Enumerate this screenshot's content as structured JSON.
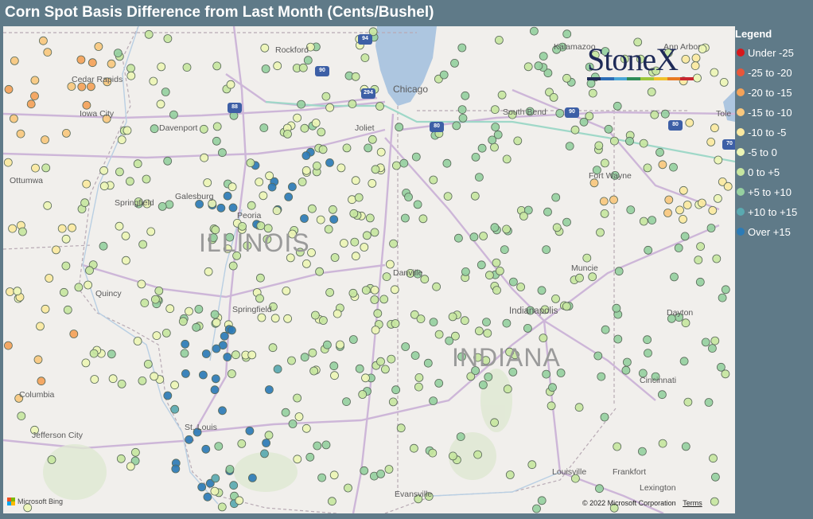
{
  "title": "Corn Spot Basis Difference from Last Month (Cents/Bushel)",
  "legend": {
    "title": "Legend",
    "items": [
      {
        "label": "Under -25",
        "color": "#d7191c"
      },
      {
        "label": "-25 to -20",
        "color": "#e8563a"
      },
      {
        "label": "-20 to -15",
        "color": "#f4a259"
      },
      {
        "label": "-15 to -10",
        "color": "#f9c87e"
      },
      {
        "label": "-10 to -5",
        "color": "#fbe9a0"
      },
      {
        "label": "-5 to 0",
        "color": "#edf5b5"
      },
      {
        "label": "0 to +5",
        "color": "#c7e6a0"
      },
      {
        "label": "+5 to +10",
        "color": "#96d0a0"
      },
      {
        "label": "+10 to +15",
        "color": "#5aa9b0"
      },
      {
        "label": "Over +15",
        "color": "#2c7bb6"
      }
    ]
  },
  "logo": {
    "text": "StoneX",
    "bar_colors": [
      "#1e2a57",
      "#2d6db5",
      "#4aa6d6",
      "#2e8b57",
      "#9cc63b",
      "#f0c22c",
      "#e87a22",
      "#c8262e"
    ]
  },
  "map": {
    "states": {
      "illinois": "ILLINOIS",
      "indiana": "INDIANA"
    },
    "cities": [
      "Chicago",
      "Rockford",
      "Kalamazoo",
      "Ann Arbor",
      "Cedar Rapids",
      "Iowa City",
      "Davenport",
      "Joliet",
      "South Bend",
      "Ottumwa",
      "Galesburg",
      "Springfield",
      "Peoria",
      "Fort Wayne",
      "Danville",
      "Muncie",
      "Quincy",
      "Indianapolis",
      "Dayton",
      "Columbia",
      "Cincinnati",
      "Jefferson City",
      "St. Louis",
      "Louisville",
      "Frankfort",
      "Evansville",
      "Lexington",
      "Tole"
    ],
    "shields": [
      "94",
      "90",
      "88",
      "294",
      "80",
      "90",
      "80",
      "70"
    ],
    "attribution": "© 2022 Microsoft Corporation",
    "terms": "Terms",
    "provider": "Microsoft Bing"
  },
  "stations": {
    "count_shown": 640
  }
}
